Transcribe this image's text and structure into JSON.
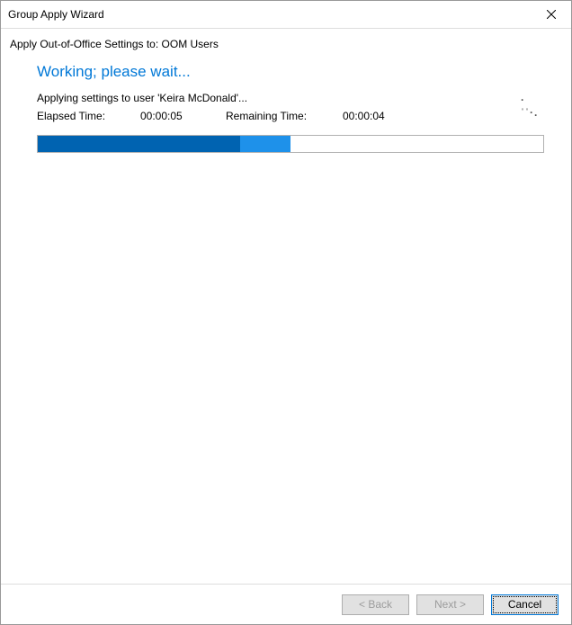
{
  "window": {
    "title": "Group Apply Wizard"
  },
  "subtitle": "Apply Out-of-Office Settings to: OOM Users",
  "heading": "Working; please wait...",
  "status": "Applying settings to user 'Keira McDonald'...",
  "time": {
    "elapsed_label": "Elapsed Time:",
    "elapsed_value": "00:00:05",
    "remaining_label": "Remaining Time:",
    "remaining_value": "00:00:04"
  },
  "progress": {
    "percent_total": 50,
    "percent_highlight_start": 40,
    "percent_highlight_end": 50
  },
  "footer": {
    "back_label": "< Back",
    "next_label": "Next >",
    "cancel_label": "Cancel",
    "back_enabled": false,
    "next_enabled": false,
    "cancel_enabled": true
  },
  "icons": {
    "close": "close-icon",
    "spinner": "spinner-icon"
  }
}
